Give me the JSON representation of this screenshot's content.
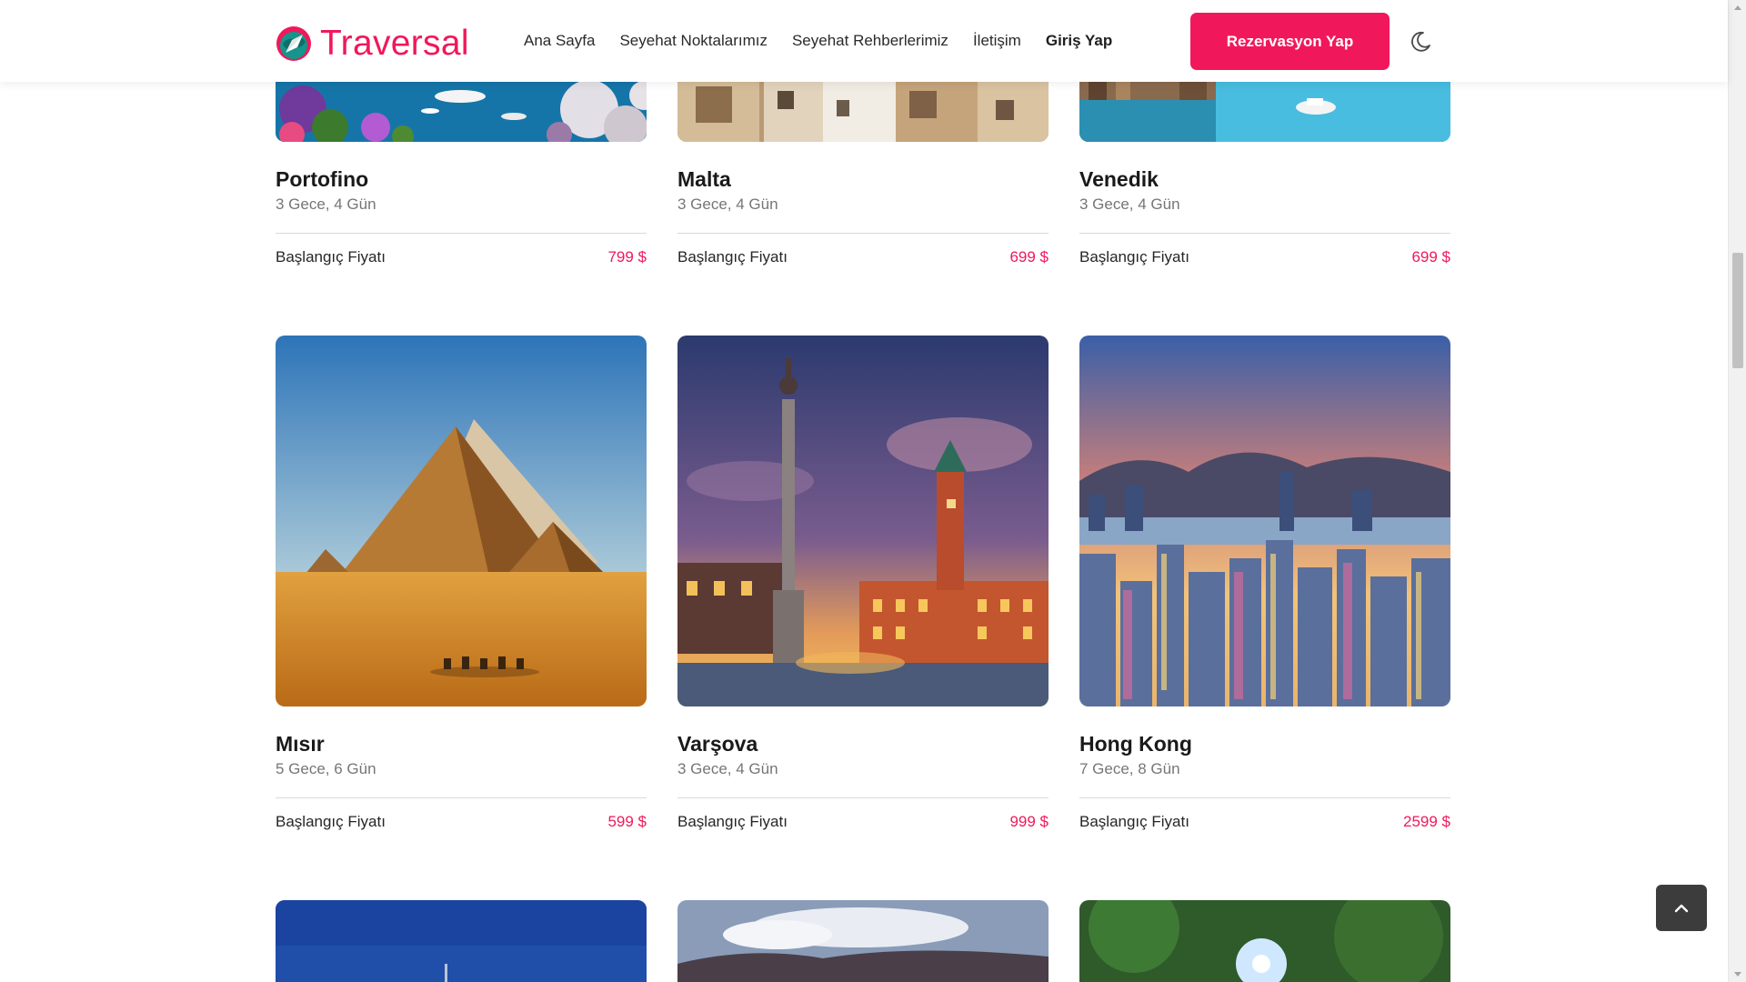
{
  "brand": {
    "name": "Traversal",
    "accent": "#f0185b",
    "icon": "compass-globe-logo"
  },
  "nav": {
    "items": [
      "Ana Sayfa",
      "Seyehat Noktalarımız",
      "Seyehat Rehberlerimiz",
      "İletişim",
      "Giriş Yap"
    ],
    "cta": "Rezervasyon Yap",
    "theme_icon": "moon-icon"
  },
  "price_label": "Başlangıç Fiyatı",
  "cards": [
    {
      "name": "Portofino",
      "duration": "3 Gece, 4 Gün",
      "price": "799 $"
    },
    {
      "name": "Malta",
      "duration": "3 Gece, 4 Gün",
      "price": "699 $"
    },
    {
      "name": "Venedik",
      "duration": "3 Gece, 4 Gün",
      "price": "699 $"
    },
    {
      "name": "Mısır",
      "duration": "5 Gece, 6 Gün",
      "price": "599 $"
    },
    {
      "name": "Varşova",
      "duration": "3 Gece, 4 Gün",
      "price": "999 $"
    },
    {
      "name": "Hong Kong",
      "duration": "7 Gece, 8 Gün",
      "price": "2599 $"
    }
  ],
  "back_to_top_icon": "chevron-up-icon"
}
